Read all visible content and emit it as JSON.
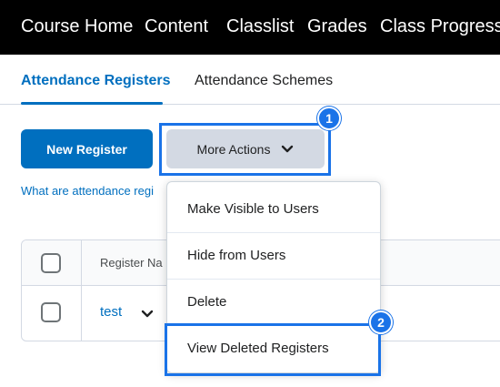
{
  "topnav": {
    "items": [
      "Course Home",
      "Content",
      "Classlist",
      "Grades",
      "Class Progress"
    ]
  },
  "tabs": {
    "active": "Attendance Registers",
    "inactive": "Attendance Schemes"
  },
  "toolbar": {
    "new_register_label": "New Register",
    "more_actions_label": "More Actions"
  },
  "help_link": "What are attendance regi",
  "table": {
    "header_name": "Register Na",
    "rows": [
      {
        "name": "test"
      }
    ]
  },
  "dropdown": {
    "items": [
      "Make Visible to Users",
      "Hide from Users",
      "Delete",
      "View Deleted Registers"
    ]
  },
  "annotations": {
    "badge_1": "1",
    "badge_2": "2"
  },
  "colors": {
    "primary": "#006fbf",
    "highlight": "#1a73e8",
    "nav_bg": "#000000",
    "secondary_button": "#d3d9e3"
  }
}
